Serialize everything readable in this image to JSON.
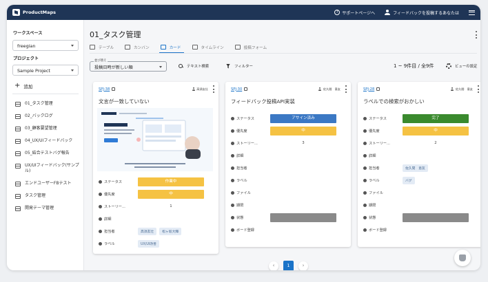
{
  "app": {
    "brand": "ProductMaps"
  },
  "topbar": {
    "support": "サポートページへ",
    "feedback": "フィードバックを投稿するあなたは"
  },
  "sidebar": {
    "workspace_label": "ワークスペース",
    "workspace_value": "freegian",
    "project_label": "プロジェクト",
    "project_value": "Sample Project",
    "add_label": "追加",
    "items": [
      {
        "label": "01_タスク管理"
      },
      {
        "label": "02_バックログ"
      },
      {
        "label": "03_顧客要望管理"
      },
      {
        "label": "04_UX/UIフィードバック"
      },
      {
        "label": "05_結合テストバグ報告"
      },
      {
        "label": "UX/UIフィードバック(サンプル)"
      },
      {
        "label": "エンドユーザーFBテスト"
      },
      {
        "label": "タスク管理"
      },
      {
        "label": "開発テーマ管理"
      }
    ]
  },
  "main": {
    "title": "01_タスク管理",
    "tabs": [
      {
        "label": "テーブル"
      },
      {
        "label": "カンバン"
      },
      {
        "label": "カード"
      },
      {
        "label": "タイムライン"
      },
      {
        "label": "投稿フォーム"
      }
    ],
    "sort": {
      "legend": "並び替え",
      "value": "投稿日時が新しい順"
    },
    "text_search": "テキスト検索",
    "filter": "フィルター",
    "count": "1 ~ 9件目 / 全9件",
    "view_settings": "ビューの設定"
  },
  "field_labels": {
    "status": "ステータス",
    "priority": "優先度",
    "story": "ストーリー...",
    "detail": "詳細",
    "owner": "担当者",
    "label": "ラベル",
    "file": "ファイル",
    "deadline": "期限",
    "state": "状態",
    "board": "ボード登録"
  },
  "cards": [
    {
      "id": "SPJ-38",
      "assignee": "高須友壮",
      "title": "文言が一致していない",
      "status": "作業中",
      "priority": "中",
      "story": "1",
      "owners": [
        "高須友壮",
        "松ヶ坂大輝"
      ],
      "labels": [
        "UX/UI改善"
      ]
    },
    {
      "id": "SPJ-30",
      "assignee": "佐久間　意友",
      "title": "フィードバック投稿API実装",
      "status": "アサイン済み",
      "priority": "中",
      "story": "3"
    },
    {
      "id": "SPJ-28",
      "assignee": "佐久間　意友",
      "title": "ラベルでの検索がおかしい",
      "status": "完了",
      "priority": "中",
      "story": "2",
      "owners": [
        "佐久間　意友"
      ],
      "labels": [
        "バグ"
      ]
    }
  ],
  "pager": {
    "current": "1",
    "prev": "‹",
    "next": "›"
  },
  "colors": {
    "header": "#1f3556",
    "accent": "#1a73c8",
    "status_working": "#f5c243",
    "status_assigned": "#3b78c4",
    "status_done": "#3a8a2e",
    "priority_mid": "#f5c243",
    "state_gray": "#8a8a8a"
  }
}
